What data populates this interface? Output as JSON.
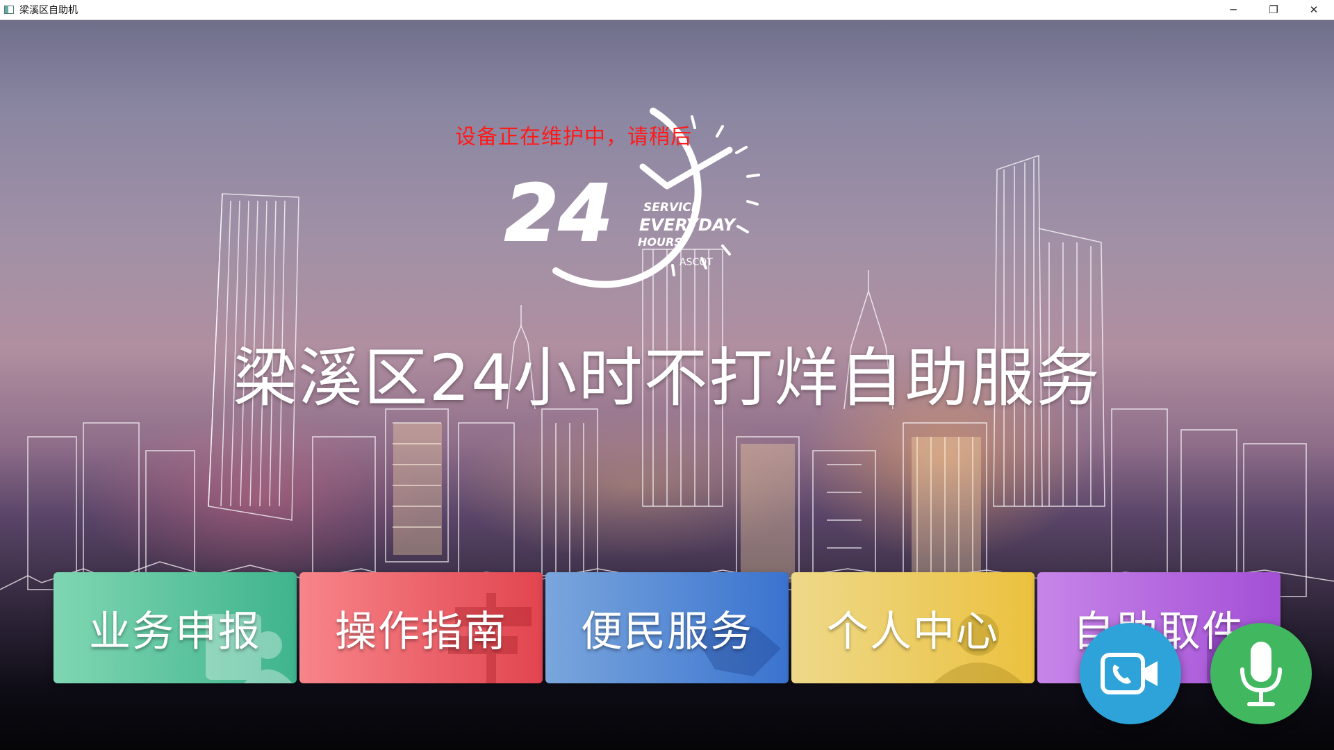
{
  "window": {
    "title": "梁溪区自助机",
    "controls": {
      "minimize": "─",
      "restore": "❐",
      "close": "✕"
    }
  },
  "notice": "设备正在维护中，请稍后",
  "logo": {
    "number": "24",
    "line1": "SERVICE",
    "line2": "EVERYDAY",
    "line3": "HOURS",
    "brand": "ASCOT"
  },
  "headline": "梁溪区24小时不打烊自助服务",
  "tiles": [
    {
      "label": "业务申报",
      "color": "#3fb48d"
    },
    {
      "label": "操作指南",
      "color": "#e2454f"
    },
    {
      "label": "便民服务",
      "color": "#3a73cf"
    },
    {
      "label": "个人中心",
      "color": "#ebc13e"
    },
    {
      "label": "自助取件",
      "color": "#a34fd6"
    }
  ],
  "fabs": {
    "video": {
      "icon": "video-call-icon",
      "color": "#2ea3d9"
    },
    "voice": {
      "icon": "microphone-icon",
      "color": "#41b85f"
    }
  }
}
